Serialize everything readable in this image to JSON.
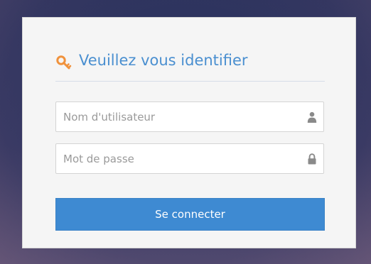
{
  "login": {
    "title": "Veuillez vous identifier",
    "username": {
      "placeholder": "Nom d'utilisateur",
      "value": ""
    },
    "password": {
      "placeholder": "Mot de passe",
      "value": ""
    },
    "submit_label": "Se connecter"
  },
  "icons": {
    "title_icon": "key-icon",
    "username_icon": "user-icon",
    "password_icon": "lock-icon"
  },
  "colors": {
    "title_text": "#4a8fd0",
    "key_icon": "#f0923c",
    "button_bg": "#3e8ad2",
    "button_text": "#ffffff",
    "panel_bg": "#f5f5f5",
    "field_icon": "#8a8a8a"
  }
}
